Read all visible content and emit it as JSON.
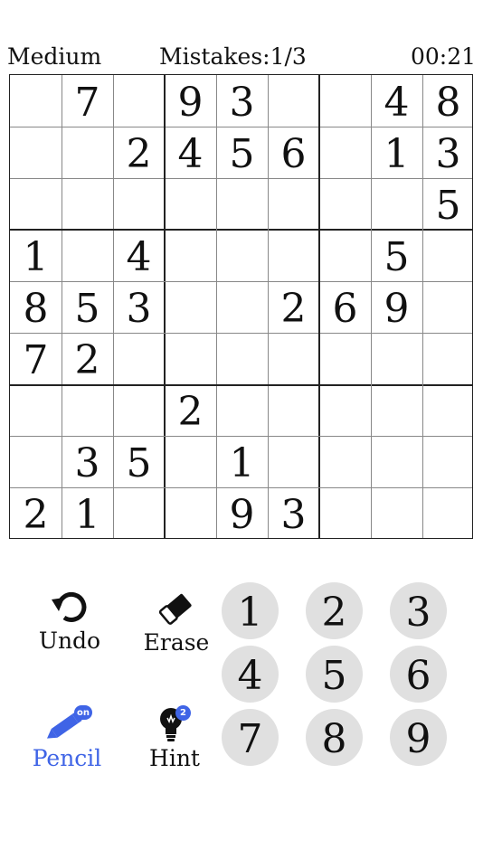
{
  "status": {
    "difficulty": "Medium",
    "mistakes": "Mistakes:1/3",
    "timer": "00:21"
  },
  "board": {
    "rows": [
      [
        "",
        "7",
        "",
        "9",
        "3",
        "",
        "",
        "4",
        "8"
      ],
      [
        "",
        "",
        "2",
        "4",
        "5",
        "6",
        "",
        "1",
        "3"
      ],
      [
        "",
        "",
        "",
        "",
        "",
        "",
        "",
        "",
        "5"
      ],
      [
        "1",
        "",
        "4",
        "",
        "",
        "",
        "",
        "5",
        ""
      ],
      [
        "8",
        "5",
        "3",
        "",
        "",
        "2",
        "6",
        "9",
        ""
      ],
      [
        "7",
        "2",
        "",
        "",
        "",
        "",
        "",
        "",
        ""
      ],
      [
        "",
        "",
        "",
        "2",
        "",
        "",
        "",
        "",
        ""
      ],
      [
        "",
        "3",
        "5",
        "",
        "1",
        "",
        "",
        "",
        ""
      ],
      [
        "2",
        "1",
        "",
        "",
        "9",
        "3",
        "",
        "",
        ""
      ]
    ]
  },
  "tools": {
    "undo": {
      "label": "Undo",
      "icon": "undo-arrow-icon"
    },
    "erase": {
      "label": "Erase",
      "icon": "eraser-icon"
    },
    "pencil": {
      "label": "Pencil",
      "icon": "pencil-icon",
      "badge": "on",
      "color": "#3f64e6"
    },
    "hint": {
      "label": "Hint",
      "icon": "lightbulb-icon",
      "badge": "2"
    }
  },
  "keypad": [
    "1",
    "2",
    "3",
    "4",
    "5",
    "6",
    "7",
    "8",
    "9"
  ],
  "colors": {
    "accent": "#3f64e6",
    "keypad_bg": "#e0e0e0",
    "grid_thick": "#222222",
    "grid_thin": "#888888"
  }
}
